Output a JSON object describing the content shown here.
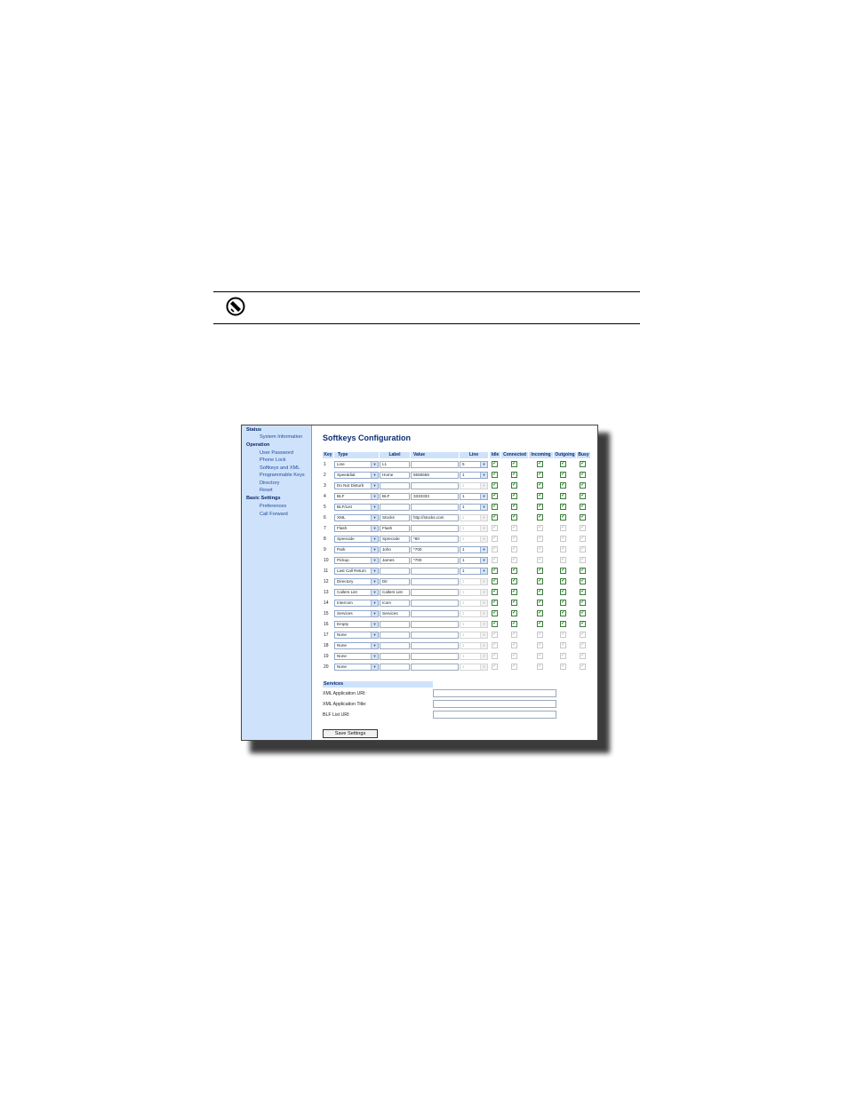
{
  "note": {
    "icon": "note-icon"
  },
  "sidebar": {
    "status_header": "Status",
    "status_items": [
      "System Information"
    ],
    "operation_header": "Operation",
    "operation_items": [
      "User Password",
      "Phone Lock",
      "Softkeys and XML",
      "Programmable Keys",
      "Directory",
      "Reset"
    ],
    "basic_header": "Basic Settings",
    "basic_items": [
      "Preferences",
      "Call Forward"
    ]
  },
  "page": {
    "title": "Softkeys Configuration"
  },
  "table": {
    "headers": [
      "Key",
      "Type",
      "Label",
      "Value",
      "Line",
      "Idle",
      "Connected",
      "Incoming",
      "Outgoing",
      "Busy"
    ],
    "rows": [
      {
        "key": "1",
        "type": "Line",
        "label": "L1",
        "value": "",
        "line": "5",
        "line_enabled": true,
        "states": [
          true,
          true,
          true,
          true,
          true
        ],
        "states_enabled": true
      },
      {
        "key": "2",
        "type": "Speeddial",
        "label": "Home",
        "value": "5555555",
        "line": "1",
        "line_enabled": true,
        "states": [
          true,
          true,
          true,
          true,
          true
        ],
        "states_enabled": true
      },
      {
        "key": "3",
        "type": "Do Not Disturb",
        "label": "",
        "value": "",
        "line": "1",
        "line_enabled": false,
        "states": [
          true,
          true,
          true,
          true,
          true
        ],
        "states_enabled": true
      },
      {
        "key": "4",
        "type": "BLF",
        "label": "BLF",
        "value": "3333333",
        "line": "1",
        "line_enabled": true,
        "states": [
          true,
          true,
          true,
          true,
          true
        ],
        "states_enabled": true
      },
      {
        "key": "5",
        "type": "BLF/List",
        "label": "",
        "value": "",
        "line": "1",
        "line_enabled": true,
        "states": [
          true,
          true,
          true,
          true,
          true
        ],
        "states_enabled": true
      },
      {
        "key": "6",
        "type": "XML",
        "label": "Stocks",
        "value": "http://stocks.com",
        "line": "1",
        "line_enabled": false,
        "states": [
          true,
          true,
          true,
          true,
          true
        ],
        "states_enabled": true
      },
      {
        "key": "7",
        "type": "Flash",
        "label": "Flash",
        "value": "",
        "line": "1",
        "line_enabled": false,
        "states": [
          true,
          true,
          true,
          true,
          true
        ],
        "states_enabled": false
      },
      {
        "key": "8",
        "type": "Sprecode",
        "label": "Sprecode",
        "value": "*80",
        "line": "1",
        "line_enabled": false,
        "states": [
          true,
          true,
          true,
          true,
          true
        ],
        "states_enabled": false
      },
      {
        "key": "9",
        "type": "Park",
        "label": "John",
        "value": "*700",
        "line": "1",
        "line_enabled": true,
        "states": [
          true,
          true,
          true,
          true,
          true
        ],
        "states_enabled": false
      },
      {
        "key": "10",
        "type": "Pickup",
        "label": "James",
        "value": "*700",
        "line": "1",
        "line_enabled": true,
        "states": [
          true,
          true,
          true,
          true,
          true
        ],
        "states_enabled": false
      },
      {
        "key": "11",
        "type": "Last Call Return",
        "label": "",
        "value": "",
        "line": "1",
        "line_enabled": true,
        "states": [
          true,
          true,
          true,
          true,
          true
        ],
        "states_enabled": true
      },
      {
        "key": "12",
        "type": "Directory",
        "label": "Dir",
        "value": "",
        "line": "1",
        "line_enabled": false,
        "states": [
          true,
          true,
          true,
          true,
          true
        ],
        "states_enabled": true
      },
      {
        "key": "13",
        "type": "Callers List",
        "label": "Callers List",
        "value": "",
        "line": "1",
        "line_enabled": false,
        "states": [
          true,
          true,
          true,
          true,
          true
        ],
        "states_enabled": true
      },
      {
        "key": "14",
        "type": "Intercom",
        "label": "Icom",
        "value": "",
        "line": "1",
        "line_enabled": false,
        "states": [
          true,
          true,
          true,
          true,
          true
        ],
        "states_enabled": true
      },
      {
        "key": "15",
        "type": "Services",
        "label": "Services",
        "value": "",
        "line": "1",
        "line_enabled": false,
        "states": [
          true,
          true,
          true,
          true,
          true
        ],
        "states_enabled": true
      },
      {
        "key": "16",
        "type": "Empty",
        "label": "",
        "value": "",
        "line": "1",
        "line_enabled": false,
        "states": [
          true,
          true,
          true,
          true,
          true
        ],
        "states_enabled": true
      },
      {
        "key": "17",
        "type": "None",
        "label": "",
        "value": "",
        "line": "1",
        "line_enabled": false,
        "states": [
          true,
          true,
          true,
          true,
          true
        ],
        "states_enabled": false
      },
      {
        "key": "18",
        "type": "None",
        "label": "",
        "value": "",
        "line": "1",
        "line_enabled": false,
        "states": [
          true,
          true,
          true,
          true,
          true
        ],
        "states_enabled": false
      },
      {
        "key": "19",
        "type": "None",
        "label": "",
        "value": "",
        "line": "1",
        "line_enabled": false,
        "states": [
          true,
          true,
          true,
          true,
          true
        ],
        "states_enabled": false
      },
      {
        "key": "20",
        "type": "None",
        "label": "",
        "value": "",
        "line": "1",
        "line_enabled": false,
        "states": [
          true,
          true,
          true,
          true,
          true
        ],
        "states_enabled": false
      }
    ]
  },
  "services": {
    "header": "Services",
    "xml_uri_label": "XML Application URI:",
    "xml_title_label": "XML Application Title:",
    "blf_list_label": "BLF List URI:",
    "xml_uri_value": "",
    "xml_title_value": "",
    "blf_list_value": ""
  },
  "save_button": "Save Settings",
  "colors": {
    "sidebar_bg": "#cfe2fb",
    "header_bg": "#cfe2fb",
    "title": "#0b2e73",
    "check": "#1f8a1f"
  }
}
